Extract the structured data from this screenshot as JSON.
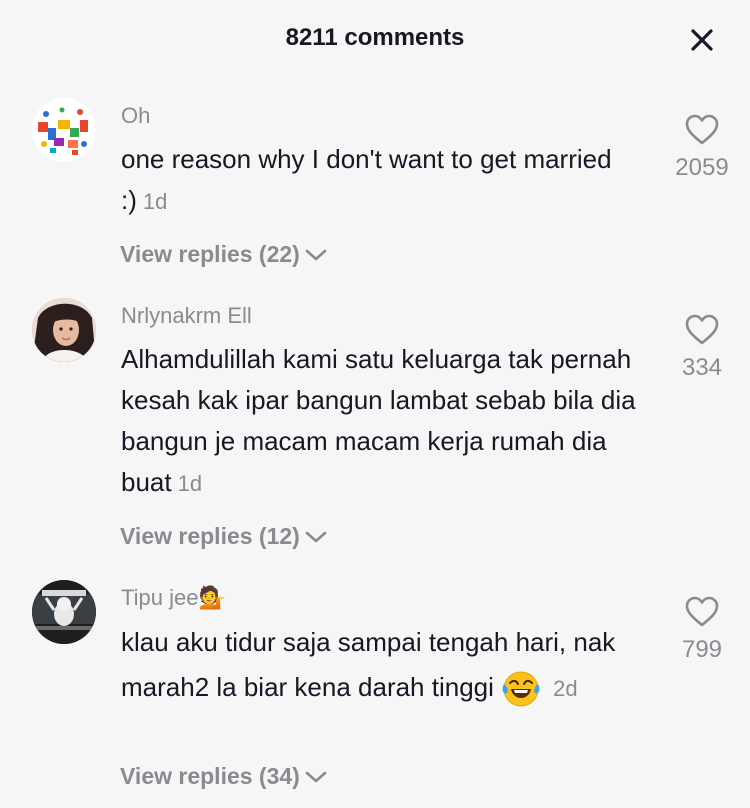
{
  "header": {
    "title": "8211 comments"
  },
  "comments": [
    {
      "username": "Oh",
      "text": "one reason why I don't want to get married :)",
      "time": "1d",
      "likes": "2059",
      "replies_label": "View replies (22)"
    },
    {
      "username": "Nrlynakrm Ell",
      "text": "Alhamdulillah kami satu keluarga tak pernah kesah kak ipar bangun lambat sebab bila dia bangun je macam macam kerja rumah dia buat",
      "time": "1d",
      "likes": "334",
      "replies_label": "View replies (12)"
    },
    {
      "username": "Tipu jee💁",
      "text": "klau aku tidur saja sampai tengah hari, nak marah2 la biar kena darah tinggi",
      "emoji": "😂",
      "time": "2d",
      "likes": "799",
      "replies_label": "View replies (34)"
    }
  ]
}
